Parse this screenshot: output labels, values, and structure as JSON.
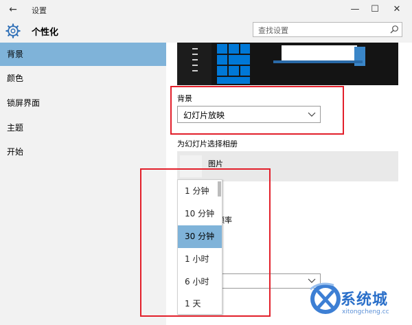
{
  "window": {
    "back_glyph": "←",
    "title": "设置",
    "minimize_glyph": "—",
    "maximize_glyph": "☐",
    "close_glyph": "✕"
  },
  "header": {
    "page_title": "个性化",
    "search_placeholder": "查找设置"
  },
  "sidebar": {
    "items": [
      {
        "label": "背景",
        "active": true
      },
      {
        "label": "颜色",
        "active": false
      },
      {
        "label": "锁屏界面",
        "active": false
      },
      {
        "label": "主题",
        "active": false
      },
      {
        "label": "开始",
        "active": false
      }
    ]
  },
  "content": {
    "background_label": "背景",
    "background_value": "幻灯片放映",
    "album_label": "为幻灯片选择相册",
    "album_name": "图片",
    "frequency_label_partial": "频率",
    "dropdown_options": [
      {
        "label": "1 分钟",
        "selected": false
      },
      {
        "label": "10 分钟",
        "selected": false
      },
      {
        "label": "30 分钟",
        "selected": true
      },
      {
        "label": "1 小时",
        "selected": false
      },
      {
        "label": "6 小时",
        "selected": false
      },
      {
        "label": "1 天",
        "selected": false
      }
    ]
  },
  "watermark": {
    "brand": "系统城",
    "url": "xitongcheng.cc"
  },
  "colors": {
    "accent_selected": "#7fb3d9",
    "sidebar_bg": "#f2f2f2",
    "highlight_border": "#e21f2a",
    "tile_blue": "#0078d7"
  }
}
